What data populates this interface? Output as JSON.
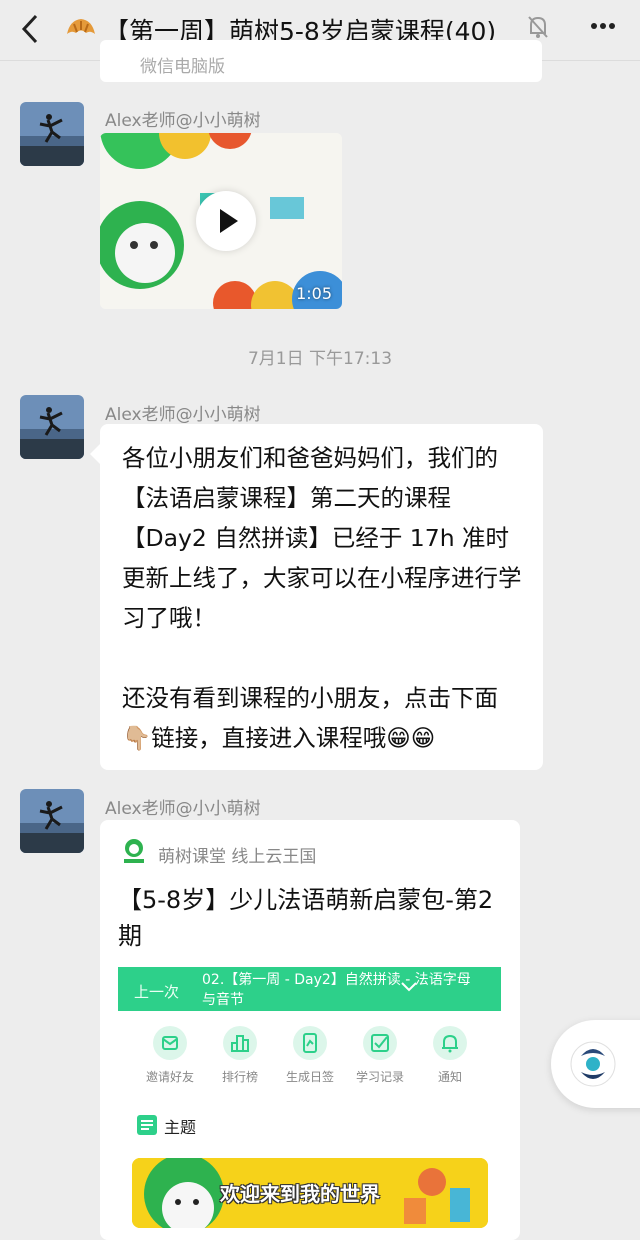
{
  "header": {
    "back_icon": "chevron-left-icon",
    "group_icon": "croissant-icon",
    "title": "【第一周】萌树5-8岁启蒙课程(40)",
    "mute_icon": "bell-muted-icon",
    "more_icon": "more-dots-icon"
  },
  "previous_card": {
    "text": "微信电脑版"
  },
  "messages": [
    {
      "sender": "Alex老师@小小萌树",
      "type": "video",
      "duration": "1:05"
    },
    {
      "sender": "Alex老师@小小萌树",
      "type": "text",
      "paragraphs": [
        "各位小朋友们和爸爸妈妈们，我们的【法语启蒙课程】第二天的课程【Day2 自然拼读】已经于 17h 准时更新上线了，大家可以在小程序进行学习了哦！",
        "还没有看到课程的小朋友，点击下面👇🏼链接，直接进入课程哦😁😁"
      ]
    },
    {
      "sender": "Alex老师@小小萌树",
      "type": "mini-program"
    }
  ],
  "timestamp": "7月1日 下午17:13",
  "mini_program": {
    "source": "萌树课堂 线上云王国",
    "title": "【5-8岁】少儿法语萌新启蒙包-第2期",
    "banner": {
      "prev_label": "上一次",
      "lesson": "02.【第一周 - Day2】自然拼读 - 法语字母与音节"
    },
    "actions": [
      {
        "label": "邀请好友",
        "icon": "invite-icon"
      },
      {
        "label": "排行榜",
        "icon": "ranking-icon"
      },
      {
        "label": "生成日签",
        "icon": "daily-card-icon"
      },
      {
        "label": "学习记录",
        "icon": "study-record-icon"
      },
      {
        "label": "通知",
        "icon": "bell-icon"
      }
    ],
    "section_label": "主题",
    "image_text": "欢迎来到我的世界"
  },
  "colors": {
    "accent_green": "#2dd08a",
    "background": "#ededed"
  }
}
